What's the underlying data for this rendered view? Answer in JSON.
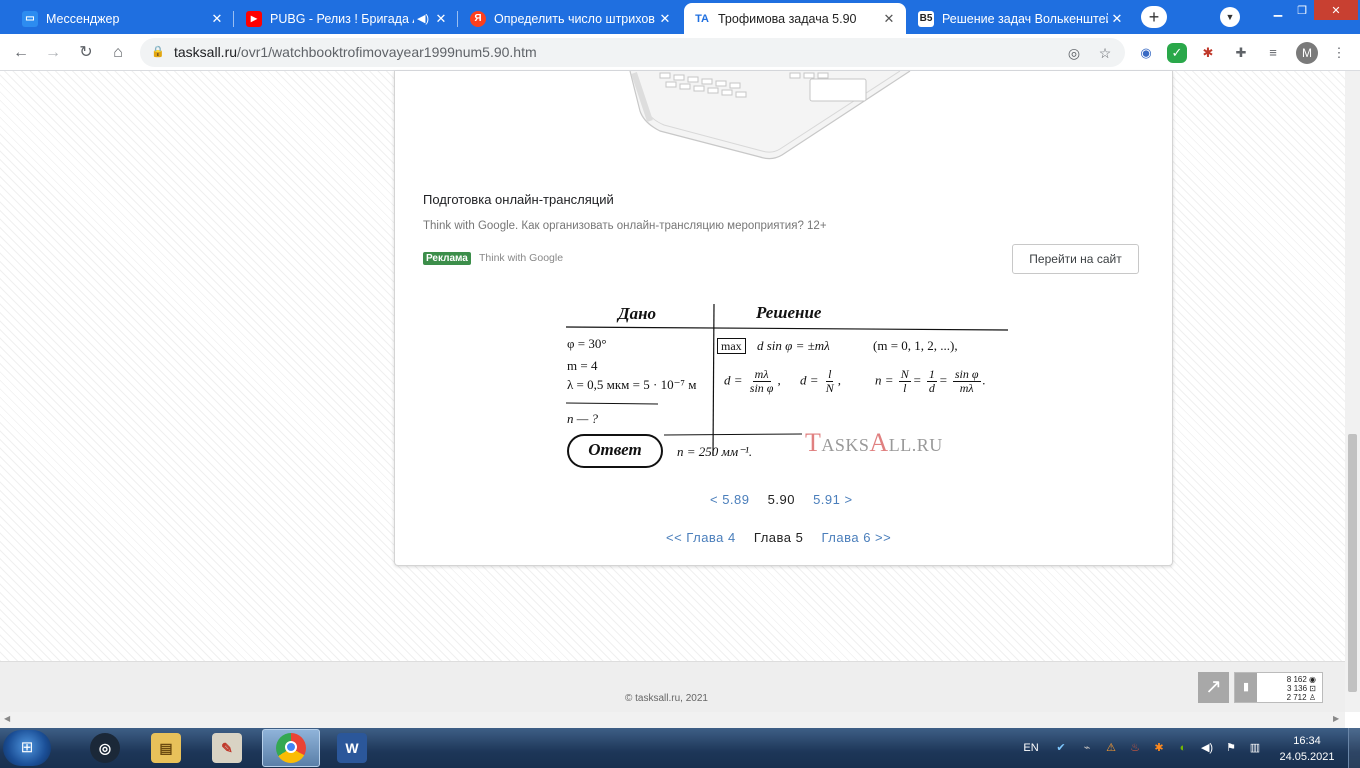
{
  "browser": {
    "tabs": [
      {
        "title": "Мессенджер",
        "favicon": "messenger-icon",
        "color": "#2d8cf0"
      },
      {
        "title": "PUBG - Релиз ! Бригада А",
        "favicon": "youtube-icon",
        "color": "#ff0000",
        "audio": "speaker-icon"
      },
      {
        "title": "Определить число штрихов с",
        "favicon": "yandex-icon",
        "color": "#fc3f1d"
      },
      {
        "title": "Трофимова задача 5.90",
        "favicon": "tasksall-icon",
        "color": "#1f6fe0",
        "active": true
      },
      {
        "title": "Решение задач Волькенштей",
        "favicon": "b5-icon",
        "color": "#222222"
      }
    ],
    "new_tab": "+",
    "url_host": "tasksall.ru",
    "url_path": "/ovr1/watchbooktrofimovayear1999num5.90.htm",
    "avatar_letter": "M"
  },
  "ad": {
    "title": "Подготовка онлайн-трансляций",
    "description": "Think with Google. Как организовать онлайн-трансляцию мероприятия? 12+",
    "badge": "Реклама",
    "source": "Think with Google",
    "button": "Перейти на сайт"
  },
  "solution": {
    "given_header": "Дано",
    "solution_header": "Решение",
    "given": [
      "φ = 30°",
      "m = 4",
      "λ = 0,5 мкм = 5 · 10⁻⁷ м"
    ],
    "unknown": "n — ?",
    "max_label": "max",
    "eq1": "d sin φ = ±mλ",
    "eq1_cond": "(m = 0, 1, 2, ...),",
    "d_lhs": "d =",
    "d_num": "mλ",
    "d_den": "sin φ",
    "d2_lhs": "d =",
    "d2_num": "l",
    "d2_den": "N",
    "n_lhs": "n =",
    "n_num1": "N",
    "n_den1": "l",
    "n_num2": "1",
    "n_den2": "d",
    "n_num3": "sin φ",
    "n_den3": "mλ",
    "answer_label": "Ответ",
    "answer": "n = 250 мм⁻¹.",
    "watermark_a": "T",
    "watermark_b": "ASKS",
    "watermark_c": "A",
    "watermark_d": "LL.RU"
  },
  "pagination": {
    "prev": "< 5.89",
    "current": "5.90",
    "next": "5.91 >"
  },
  "chapters": {
    "prev": "<< Глава 4",
    "current": "Глава 5",
    "next": "Глава 6 >>"
  },
  "footer": {
    "copyright": "© tasksall.ru, 2021",
    "counter": [
      "8 162",
      "3 136",
      "2 712"
    ]
  },
  "taskbar": {
    "apps": [
      "steam-icon",
      "explorer-icon",
      "paint-icon",
      "chrome-icon",
      "word-icon"
    ],
    "language": "EN",
    "time": "16:34",
    "date": "24.05.2021"
  }
}
